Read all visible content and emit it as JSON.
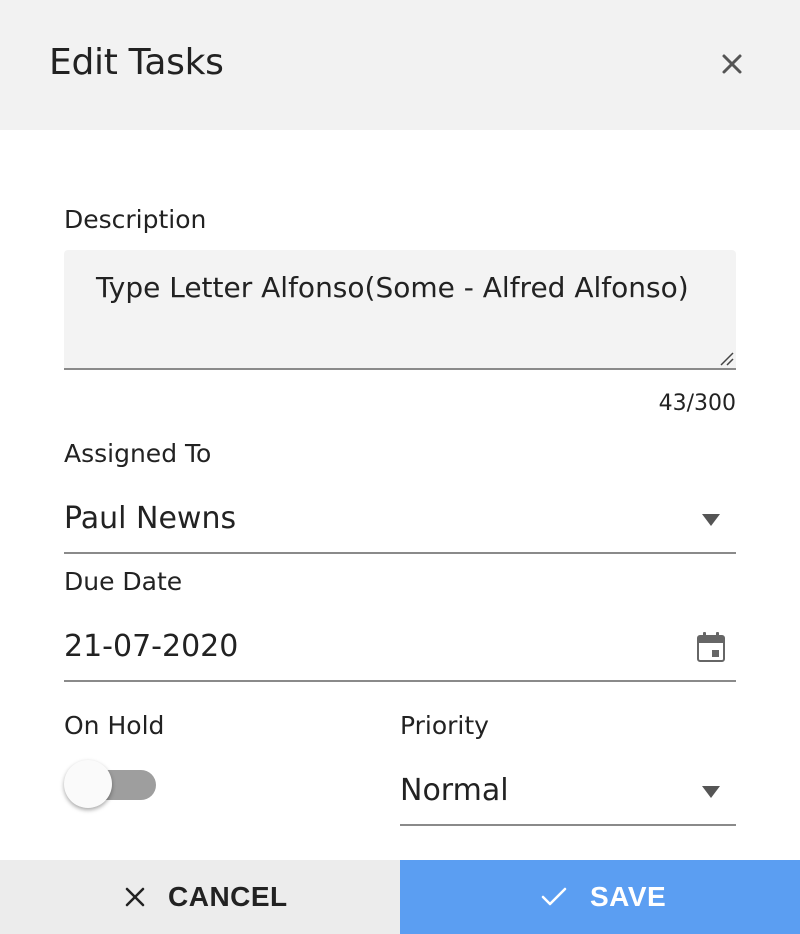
{
  "dialog": {
    "title": "Edit Tasks",
    "close_icon": "close-icon"
  },
  "description": {
    "label": "Description",
    "value": "Type Letter Alfonso(Some  - Alfred Alfonso)",
    "counter": "43/300"
  },
  "assigned_to": {
    "label": "Assigned To",
    "value": "Paul Newns",
    "icon": "dropdown-arrow-icon"
  },
  "due_date": {
    "label": "Due Date",
    "value": "21-07-2020",
    "icon": "calendar-icon"
  },
  "on_hold": {
    "label": "On Hold",
    "checked": false
  },
  "priority": {
    "label": "Priority",
    "value": "Normal",
    "icon": "dropdown-arrow-icon"
  },
  "footer": {
    "cancel_label": "CANCEL",
    "cancel_icon": "close-icon",
    "save_label": "SAVE",
    "save_icon": "check-icon"
  },
  "colors": {
    "header_bg": "#f2f2f2",
    "save_bg": "#5b9ef2",
    "cancel_bg": "#ececec",
    "field_underline": "#8a8a8a",
    "toggle_off_track": "#9e9e9e"
  }
}
